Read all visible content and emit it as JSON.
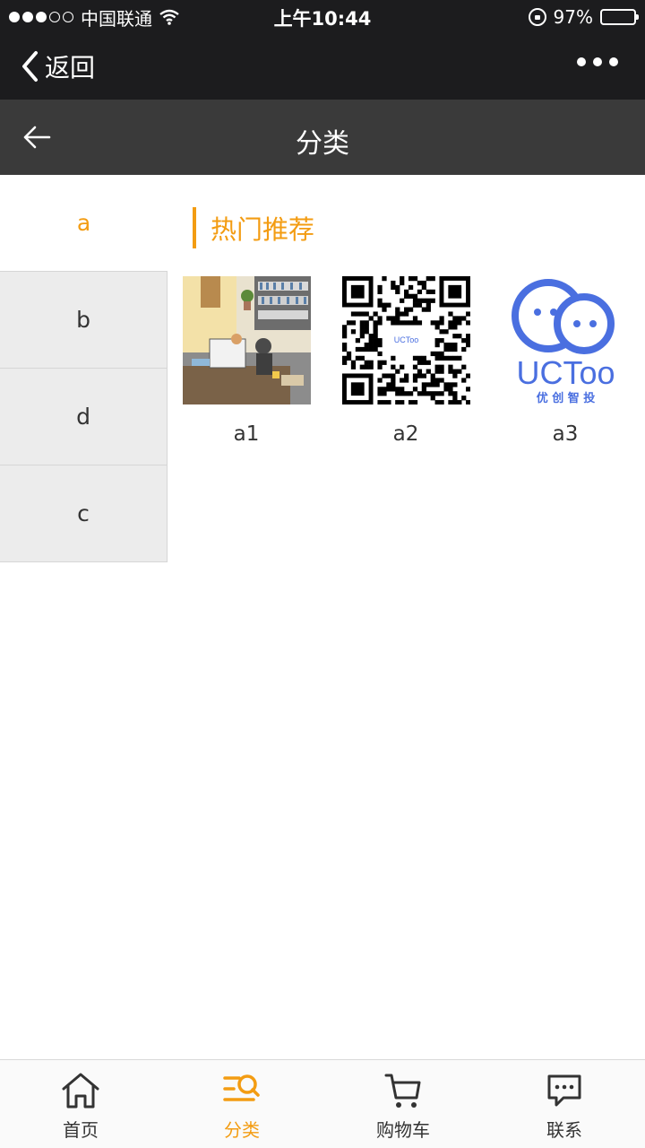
{
  "status_bar": {
    "carrier": "中国联通",
    "time": "上午10:44",
    "battery": "97%",
    "battery_level": 0.97,
    "signal_bars_filled": 3,
    "signal_bars_total": 5
  },
  "wechat_nav": {
    "back_label": "返回",
    "icons": {
      "back": "chevron-left-icon",
      "more": "more-dots-icon"
    }
  },
  "header": {
    "title": "分类",
    "icons": {
      "back": "arrow-left-icon"
    }
  },
  "categories": [
    {
      "label": "a",
      "active": true
    },
    {
      "label": "b",
      "active": false
    },
    {
      "label": "d",
      "active": false
    },
    {
      "label": "c",
      "active": false
    }
  ],
  "section": {
    "title": "热门推荐"
  },
  "products": [
    {
      "name": "a1",
      "image": "illustration-office-cats"
    },
    {
      "name": "a2",
      "image": "qr-code",
      "image_text": "UCToo"
    },
    {
      "name": "a3",
      "image": "uctoo-logo",
      "logo_text": "UCToo",
      "logo_subtext": "优 创 智 投"
    }
  ],
  "tabbar": {
    "items": [
      {
        "label": "首页",
        "icon": "home-icon",
        "active": false
      },
      {
        "label": "分类",
        "icon": "category-search-icon",
        "active": true
      },
      {
        "label": "购物车",
        "icon": "cart-icon",
        "active": false
      },
      {
        "label": "联系",
        "icon": "message-icon",
        "active": false
      }
    ]
  },
  "colors": {
    "accent": "#f39c12",
    "statusbar_bg": "#1c1c1e",
    "header_bg": "#3a3a3a",
    "category_bg": "#ececec",
    "logo_blue": "#4a6fe0"
  }
}
